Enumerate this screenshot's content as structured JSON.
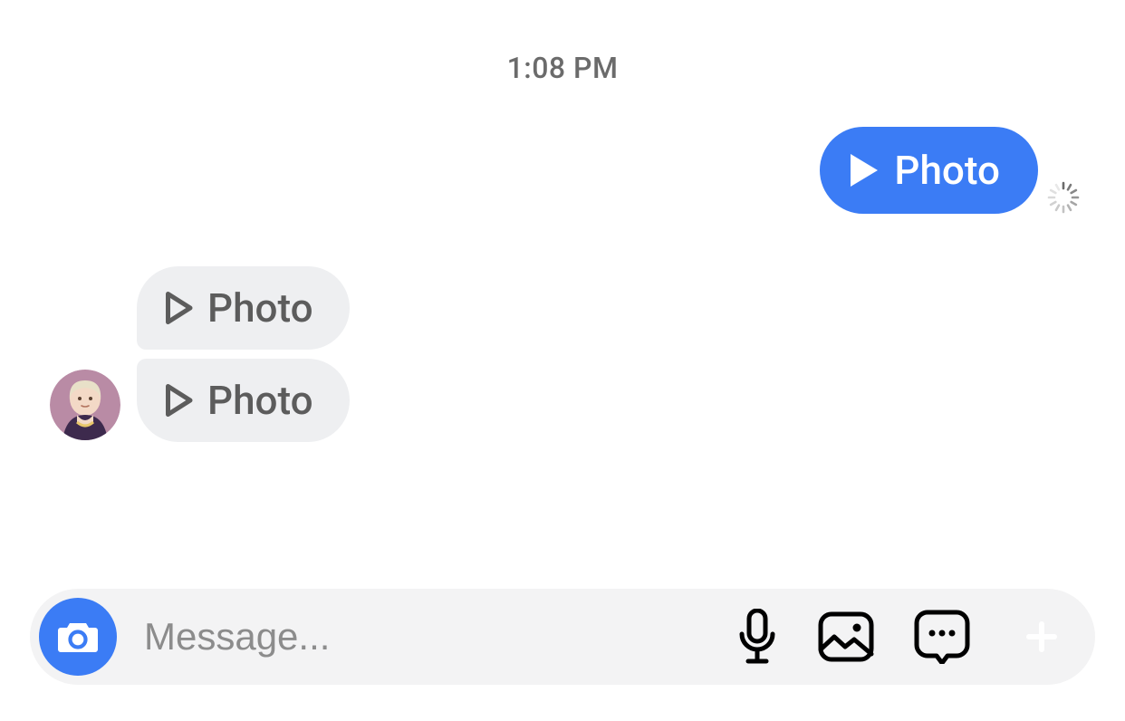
{
  "timestamp": "1:08 PM",
  "messages": {
    "outgoing": {
      "label": "Photo",
      "status": "sending"
    },
    "incoming": [
      {
        "label": "Photo"
      },
      {
        "label": "Photo"
      }
    ]
  },
  "composer": {
    "placeholder": "Message..."
  },
  "colors": {
    "accent": "#3b7cf5",
    "bubble_incoming": "#eeeff1",
    "text_muted": "#6b6b6b"
  }
}
